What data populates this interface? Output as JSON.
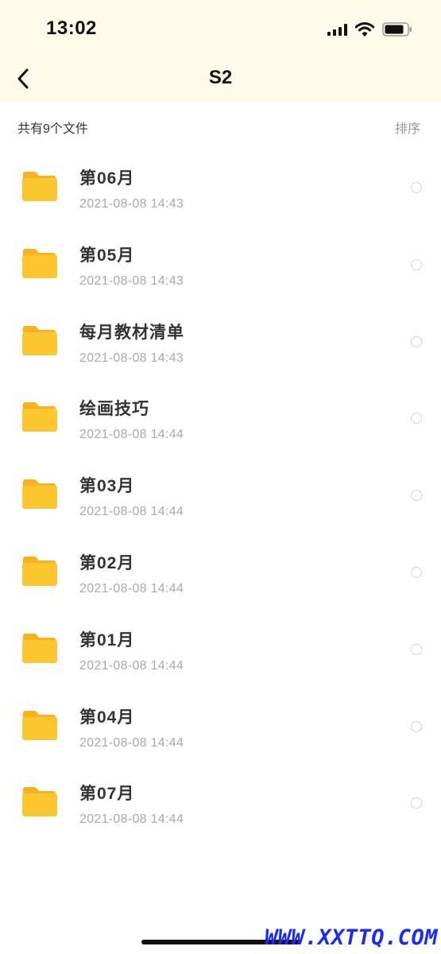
{
  "status_bar": {
    "time": "13:02",
    "icons": [
      "signal-icon",
      "wifi-icon",
      "battery-icon"
    ]
  },
  "nav": {
    "title": "S2",
    "back_icon": "chevron-left-icon"
  },
  "summary": {
    "count_label": "共有9个文件",
    "sort_label": "排序"
  },
  "files": [
    {
      "name": "第06月",
      "date": "2021-08-08 14:43",
      "icon": "folder-icon"
    },
    {
      "name": "第05月",
      "date": "2021-08-08 14:43",
      "icon": "folder-icon"
    },
    {
      "name": "每月教材清单",
      "date": "2021-08-08 14:43",
      "icon": "folder-icon"
    },
    {
      "name": "绘画技巧",
      "date": "2021-08-08 14:44",
      "icon": "folder-icon"
    },
    {
      "name": "第03月",
      "date": "2021-08-08 14:44",
      "icon": "folder-icon"
    },
    {
      "name": "第02月",
      "date": "2021-08-08 14:44",
      "icon": "folder-icon"
    },
    {
      "name": "第01月",
      "date": "2021-08-08 14:44",
      "icon": "folder-icon"
    },
    {
      "name": "第04月",
      "date": "2021-08-08 14:44",
      "icon": "folder-icon"
    },
    {
      "name": "第07月",
      "date": "2021-08-08 14:44",
      "icon": "folder-icon"
    }
  ],
  "watermark": "WWW.XXTTQ.COM",
  "colors": {
    "header_bg": "#fefaea",
    "folder_yellow": "#fcc630",
    "date_gray": "#a5a9b3",
    "watermark_blue": "#1b2cf0"
  }
}
